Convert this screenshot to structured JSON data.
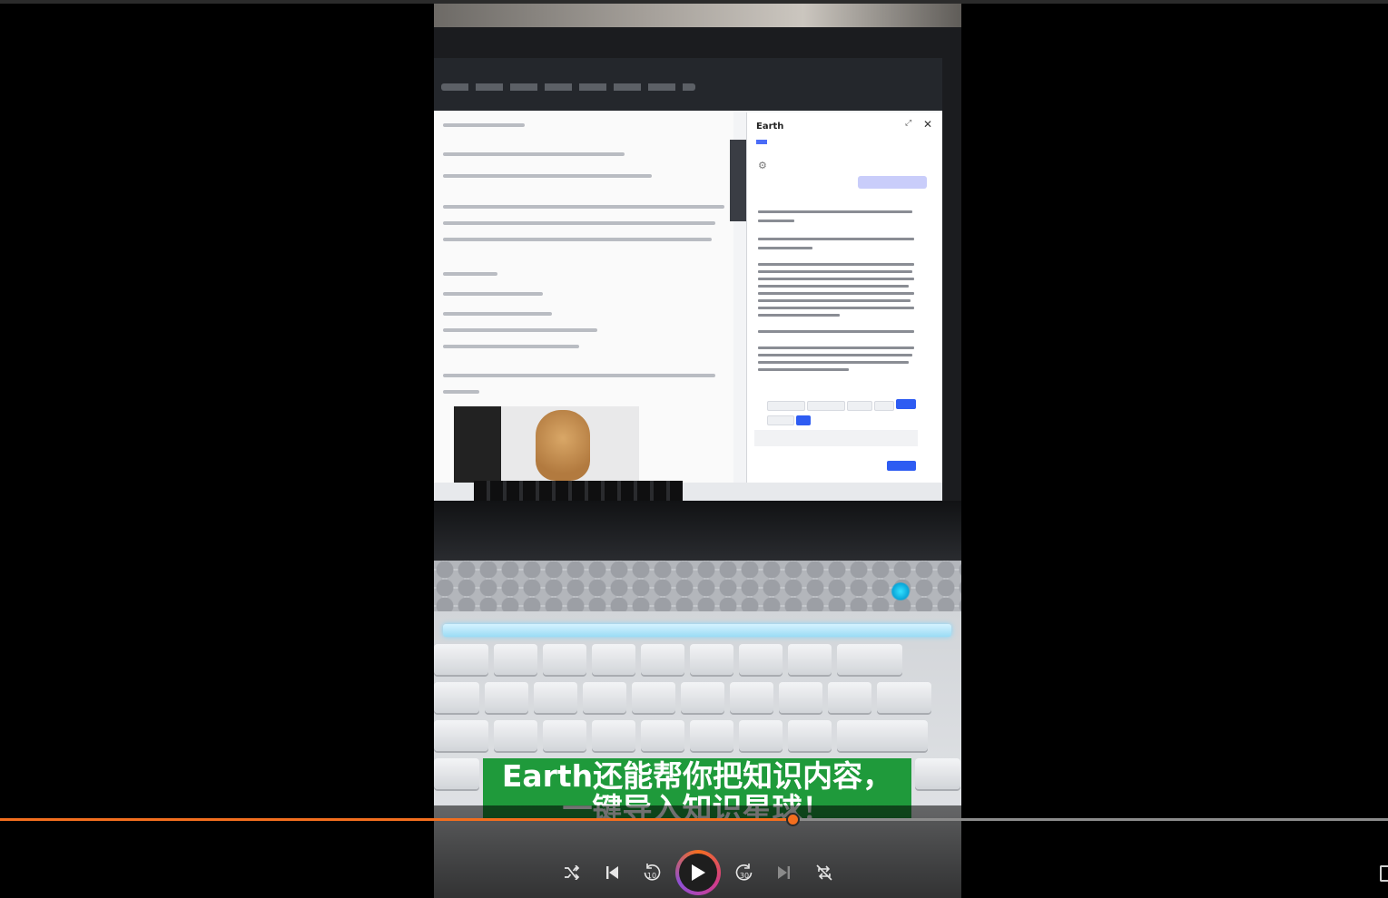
{
  "player": {
    "progress_fraction": 0.571,
    "accent_color": "#f36e1e",
    "controls": [
      {
        "name": "shuffle-button",
        "icon": "shuffle-icon"
      },
      {
        "name": "previous-button",
        "icon": "skip-previous-icon"
      },
      {
        "name": "rewind-10-button",
        "icon": "rewind-10-icon",
        "label": "10"
      },
      {
        "name": "play-button",
        "icon": "play-icon"
      },
      {
        "name": "forward-30-button",
        "icon": "forward-30-icon",
        "label": "30"
      },
      {
        "name": "next-button",
        "icon": "skip-next-icon"
      },
      {
        "name": "repeat-off-button",
        "icon": "repeat-off-icon"
      }
    ]
  },
  "video": {
    "subtitle_line1": "Earth还能帮你把知识内容，",
    "subtitle_line2": "一键导入知识星球！",
    "panel_title": "Earth",
    "subtitle_bg_color": "#1f9a3b"
  }
}
